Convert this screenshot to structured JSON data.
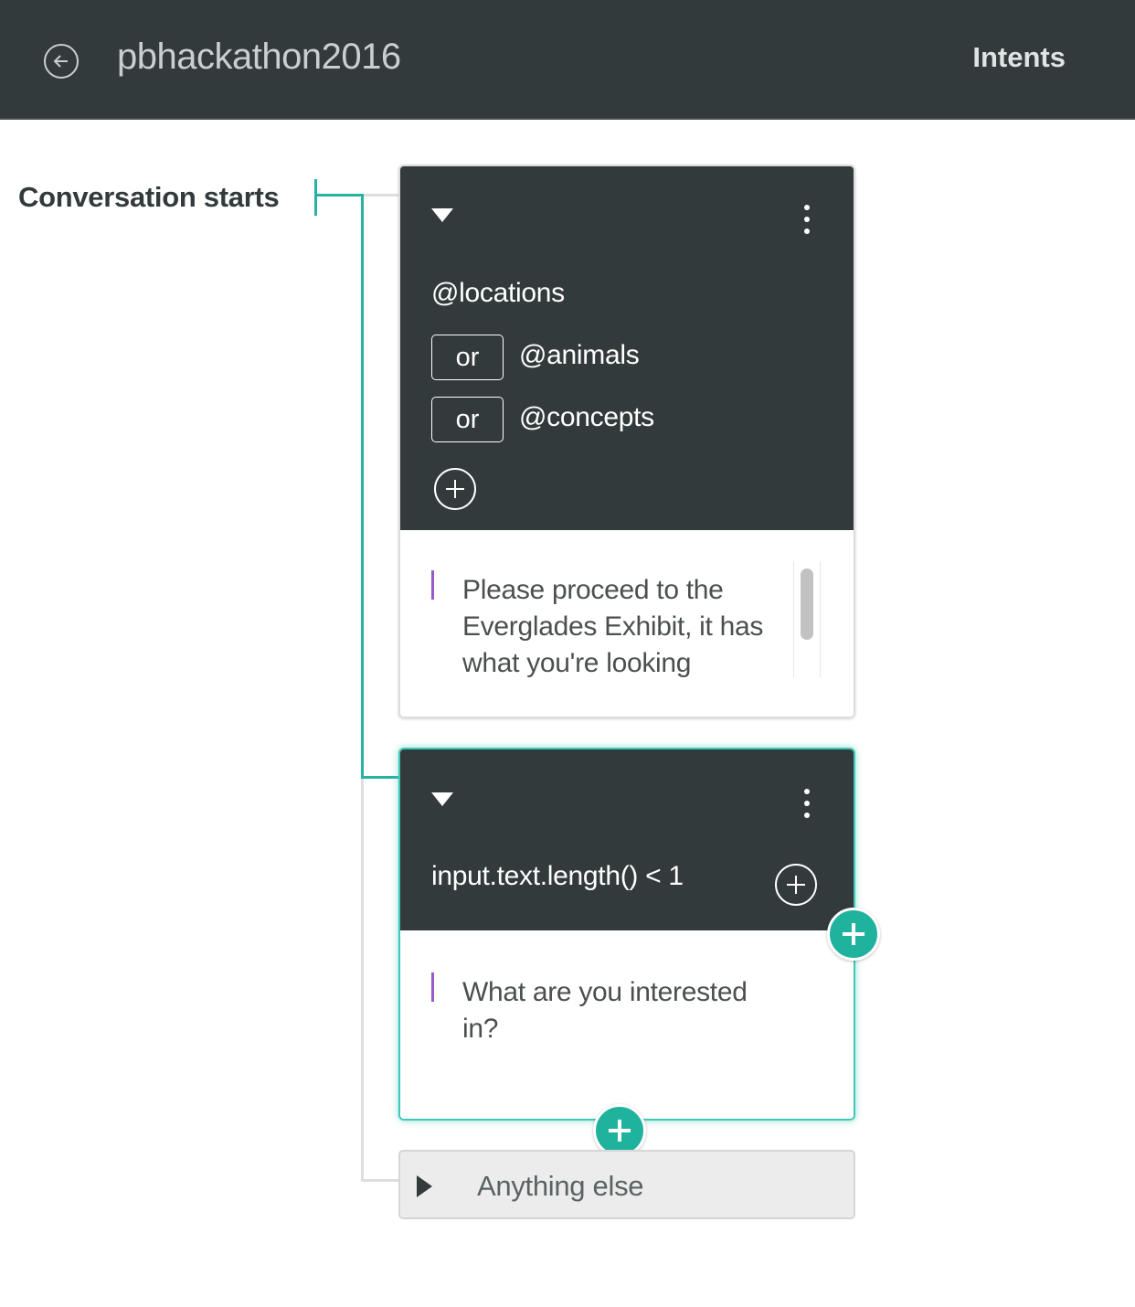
{
  "header": {
    "back_icon": "arrow-left-circle-icon",
    "workspace_name": "pbhackathon2016",
    "nav_link": "Intents"
  },
  "tree": {
    "root_label": "Conversation starts",
    "line_color": "#26b3a4"
  },
  "nodes": [
    {
      "condition": "@locations",
      "or_conditions": [
        {
          "operator": "or",
          "value": "@animals"
        },
        {
          "operator": "or",
          "value": "@concepts"
        }
      ],
      "response": "Please proceed to the Everglades Exhibit, it has what you're looking",
      "selected": false
    },
    {
      "condition": "input.text.length() < 1",
      "or_conditions": [],
      "response": "What are you interested in?",
      "selected": true
    }
  ],
  "fallback": {
    "label": "Anything else"
  },
  "colors": {
    "header_bg": "#323a3c",
    "accent": "#1fb39e",
    "selection_glow": "#3fc8b8",
    "response_marker": "#9b59c9"
  }
}
